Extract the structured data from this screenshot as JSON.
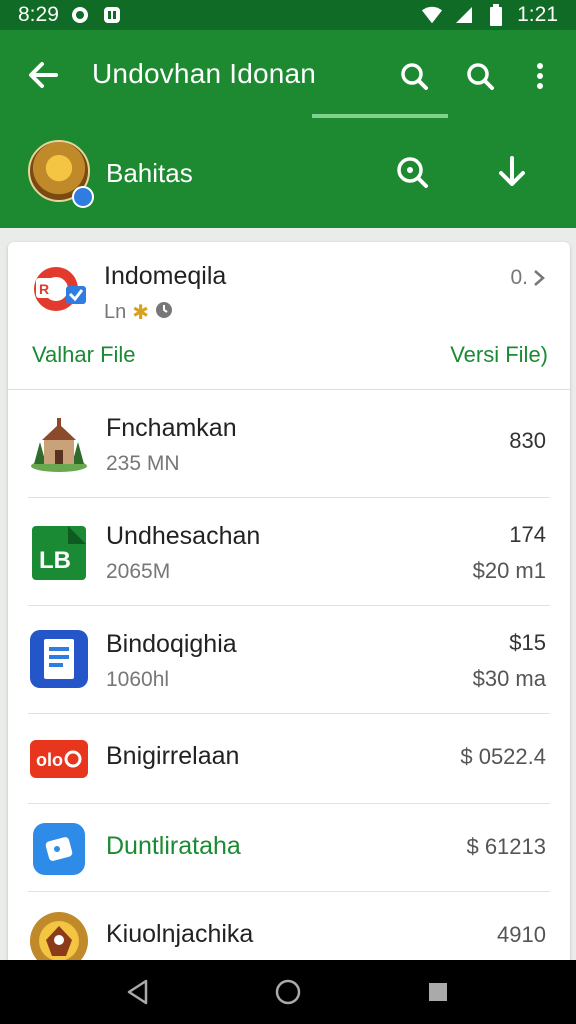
{
  "status_bar": {
    "time": "8:29",
    "right_time": "1:21",
    "colors": {
      "background": "#0f6b25"
    }
  },
  "app_bar": {
    "title": "Undovhan Idonan",
    "back_icon": "arrow-left-icon",
    "actions": [
      "search-icon",
      "search-icon",
      "more-vert-icon"
    ],
    "colors": {
      "background": "#1d8a31",
      "tab_indicator": "#7fd38e"
    }
  },
  "sub_bar": {
    "title": "Bahitas",
    "actions": [
      "search-icon",
      "download-icon"
    ]
  },
  "header_item": {
    "title": "Indomeqila",
    "subtitle": "Ln",
    "value": "0.",
    "left_link": "Valhar File",
    "right_link": "Versi File)"
  },
  "items": [
    {
      "title": "Fnchamkan",
      "sub": "235 MN",
      "value1": "830",
      "value2": "",
      "icon": "temple-icon",
      "title_color": "#222222"
    },
    {
      "title": "Undhesachan",
      "sub": "2065M",
      "value1": "174",
      "value2": "$20 m1",
      "icon": "lb-app-icon",
      "title_color": "#222222"
    },
    {
      "title": "Bindoqighia",
      "sub": "1060hl",
      "value1": "$15",
      "value2": "$30 ma",
      "icon": "document-app-icon",
      "title_color": "#222222"
    },
    {
      "title": "Bnigirrelaan",
      "sub": "",
      "value1": "$ 0522.4",
      "value2": "",
      "icon": "red-logo-icon",
      "title_color": "#222222"
    },
    {
      "title": "Duntliratahа",
      "sub": "",
      "value1": "$ 61213",
      "value2": "",
      "icon": "blue-app-icon",
      "title_color": "#1b8a34"
    },
    {
      "title": "Kiuolnjachika",
      "sub": "",
      "value1": "4910",
      "value2": "",
      "icon": "emblem-icon",
      "title_color": "#222222"
    }
  ],
  "nav_bar": {
    "buttons": [
      "back-triangle-icon",
      "home-circle-icon",
      "recents-square-icon"
    ]
  }
}
